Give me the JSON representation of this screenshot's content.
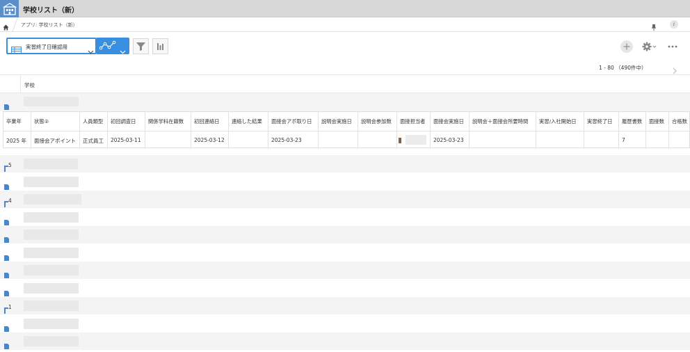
{
  "app": {
    "title": "学校リスト（新）"
  },
  "breadcrumb": {
    "text": "アプリ: 学校リスト（新）"
  },
  "toolbar": {
    "view_label": "実習終了日確認用",
    "filter_icon": "filter-icon",
    "summary_icon": "bar-chart-icon",
    "add_icon": "plus-icon",
    "settings_icon": "gear-icon",
    "more_icon": "more-icon"
  },
  "pager": {
    "text": "1 - 80 （490件中）"
  },
  "list": {
    "column_header": "学校"
  },
  "subtable": {
    "headers": [
      "卒業年",
      "状態②",
      "人員類型",
      "初回調査日",
      "関係学科在籍数",
      "初回連絡日",
      "連絡した結果",
      "面接会アポ取り日",
      "説明会実施日",
      "説明会参加数",
      "面接担当者",
      "面接会実施日",
      "説明会＋面接会所要時間",
      "実習/入社開始日",
      "実習終了日",
      "履歴書数",
      "面接数",
      "合格数"
    ],
    "values": [
      "2025 年",
      "面接会アポイント",
      "正式員工",
      "2025-03-11",
      "",
      "2025-03-12",
      "",
      "2025-03-23",
      "",
      "",
      "",
      "2025-03-23",
      "",
      "",
      "",
      "7",
      "",
      ""
    ]
  },
  "rows": [
    {
      "badge": "5"
    },
    {
      "badge": ""
    },
    {
      "badge": "4"
    },
    {
      "badge": ""
    },
    {
      "badge": ""
    },
    {
      "badge": ""
    },
    {
      "badge": ""
    },
    {
      "badge": ""
    },
    {
      "badge": "1"
    },
    {
      "badge": ""
    },
    {
      "badge": ""
    }
  ],
  "colors": {
    "accent": "#3a8ee0",
    "topbar": "#d8d8d8",
    "placeholder": "#e9e9e9",
    "row_alt": "#f4f4f4",
    "doc_icon": "#4a86c8"
  }
}
